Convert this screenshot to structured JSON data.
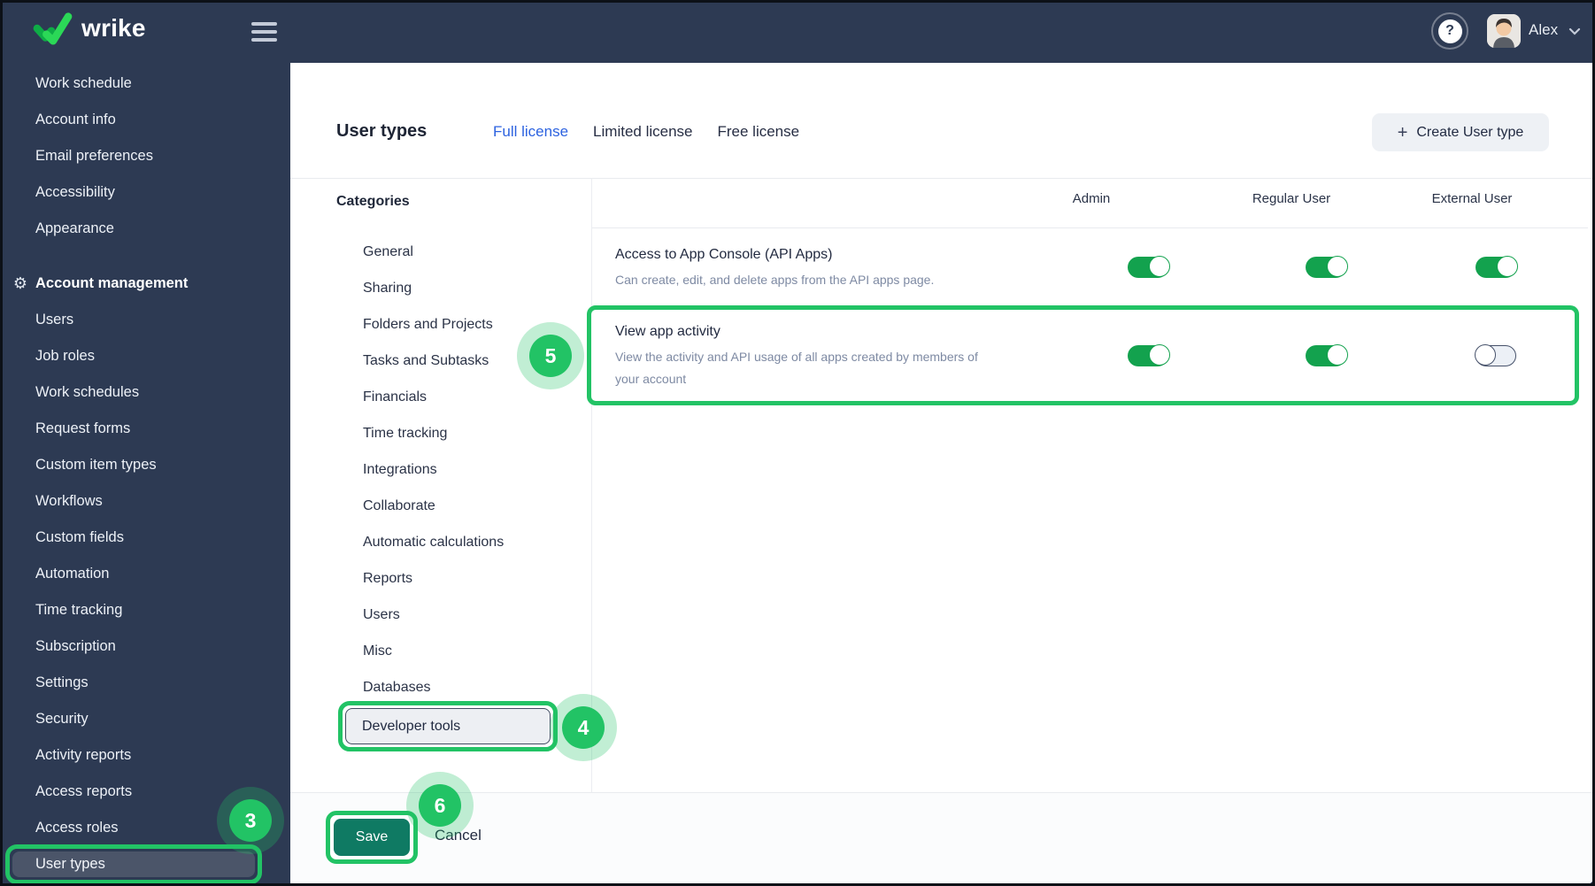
{
  "topbar": {
    "brand": "wrike",
    "user_name": "Alex",
    "help_glyph": "?"
  },
  "sidebar": {
    "top_items": [
      "Work schedule",
      "Account info",
      "Email preferences",
      "Accessibility",
      "Appearance"
    ],
    "section_label": "Account management",
    "items": [
      "Users",
      "Job roles",
      "Work schedules",
      "Request forms",
      "Custom item types",
      "Workflows",
      "Custom fields",
      "Automation",
      "Time tracking",
      "Subscription",
      "Settings",
      "Security",
      "Activity reports",
      "Access reports",
      "Access roles"
    ],
    "selected_item": "User types"
  },
  "main": {
    "title": "User types",
    "tabs": [
      {
        "label": "Full license",
        "active": true
      },
      {
        "label": "Limited license",
        "active": false
      },
      {
        "label": "Free license",
        "active": false
      }
    ],
    "create_button_label": "Create User type",
    "categories_label": "Categories",
    "categories": [
      "General",
      "Sharing",
      "Folders and Projects",
      "Tasks and Subtasks",
      "Financials",
      "Time tracking",
      "Integrations",
      "Collaborate",
      "Automatic calculations",
      "Reports",
      "Users",
      "Misc",
      "Databases"
    ],
    "selected_category": "Developer tools",
    "table": {
      "columns": [
        "Admin",
        "Regular User",
        "External User"
      ],
      "rows": [
        {
          "title": "Access to App Console (API Apps)",
          "description": "Can create, edit, and delete apps from the API apps page.",
          "toggles": [
            true,
            true,
            true
          ],
          "highlighted": false
        },
        {
          "title": "View app activity",
          "description": "View the activity and API usage of all apps created by members of your account",
          "toggles": [
            true,
            true,
            false
          ],
          "highlighted": true
        }
      ]
    },
    "footer": {
      "save_label": "Save",
      "cancel_label": "Cancel"
    }
  },
  "annotations": {
    "sidebar_step": "3",
    "category_step": "4",
    "row_step": "5",
    "save_step": "6"
  },
  "colors": {
    "annotation_green": "#22c365",
    "toggle_on_green": "#13a24e",
    "save_button_green": "#0f7a63",
    "active_tab_blue": "#2d63e0",
    "sidebar_navy": "#2d3a53",
    "selected_item_navy": "#4b5569"
  }
}
